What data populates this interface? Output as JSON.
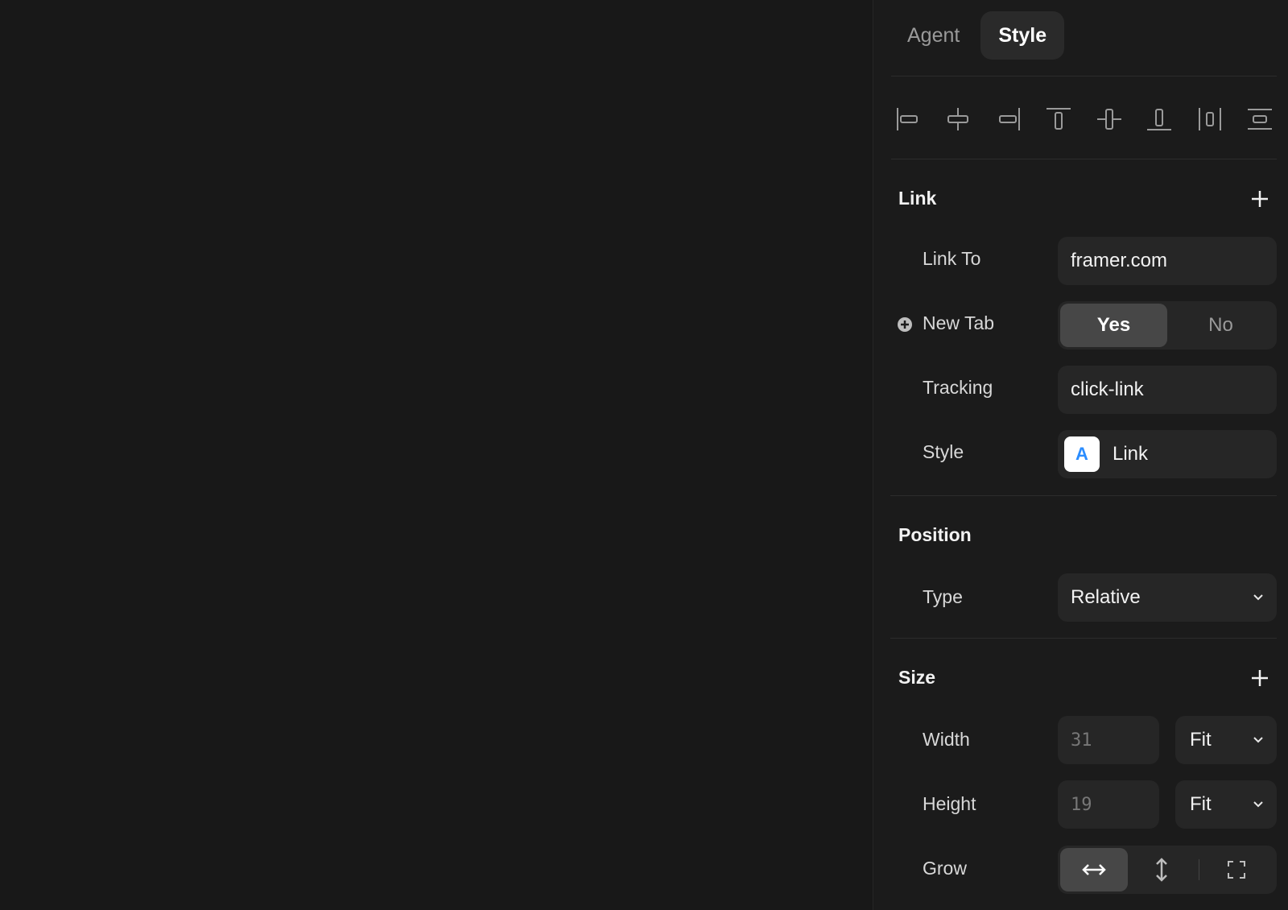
{
  "tabs": [
    {
      "label": "Agent",
      "active": false
    },
    {
      "label": "Style",
      "active": true
    }
  ],
  "alignment_icons": [
    "align-left-icon",
    "align-center-horizontal-icon",
    "align-right-icon",
    "align-top-icon",
    "align-center-vertical-icon",
    "align-bottom-icon",
    "distribute-horizontal-icon",
    "distribute-vertical-icon"
  ],
  "link": {
    "title": "Link",
    "link_to_label": "Link To",
    "link_to_value": "framer.com",
    "new_tab_label": "New Tab",
    "new_tab_options": [
      "Yes",
      "No"
    ],
    "new_tab_selected": "Yes",
    "tracking_label": "Tracking",
    "tracking_value": "click-link",
    "style_label": "Style",
    "style_swatch_letter": "A",
    "style_value": "Link"
  },
  "position": {
    "title": "Position",
    "type_label": "Type",
    "type_value": "Relative"
  },
  "size": {
    "title": "Size",
    "width_label": "Width",
    "width_value": "31",
    "width_mode": "Fit",
    "height_label": "Height",
    "height_value": "19",
    "height_mode": "Fit",
    "grow_label": "Grow",
    "grow_selected": "horizontal"
  },
  "colors": {
    "background": "#181818",
    "panel": "#1b1b1b",
    "field": "#262626",
    "active_segment": "#474747",
    "accent_blue": "#2b8dff"
  }
}
